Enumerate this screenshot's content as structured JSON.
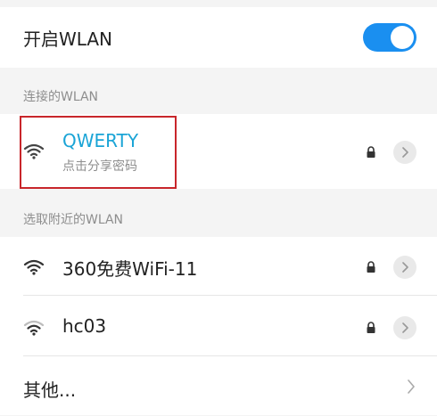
{
  "wlan_toggle": {
    "label": "开启WLAN",
    "state": "on",
    "accent": "#1a8ff0"
  },
  "connected": {
    "header": "连接的WLAN",
    "network": {
      "name": "QWERTY",
      "subtitle": "点击分享密码",
      "name_color": "#1aa4d6"
    },
    "highlight_color": "#c8262b"
  },
  "nearby": {
    "header": "选取附近的WLAN",
    "networks": [
      {
        "name": "360免费WiFi-11",
        "icon": "wifi-strong-icon",
        "secured": true
      },
      {
        "name": "hc03",
        "icon": "wifi-medium-icon",
        "secured": true
      }
    ],
    "other_label": "其他..."
  }
}
